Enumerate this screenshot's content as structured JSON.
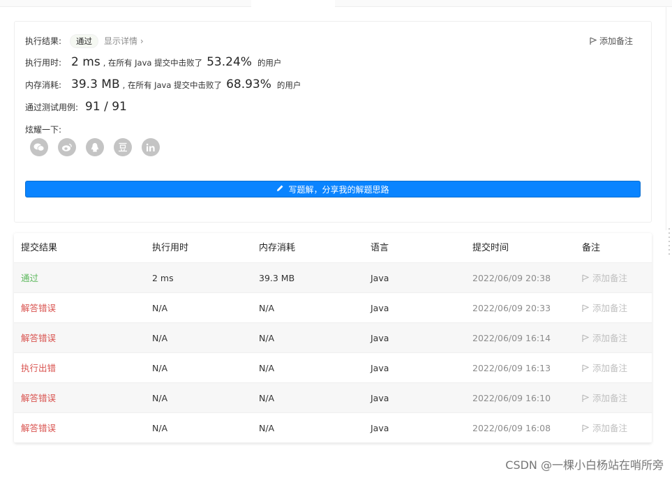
{
  "result": {
    "exec_result_label": "执行结果:",
    "exec_result_value": "通过",
    "show_details": "显示详情",
    "show_details_chevron": "›",
    "add_note": "添加备注",
    "time_label": "执行用时:",
    "time_value": "2 ms",
    "time_mid": ", 在所有 Java 提交中击败了",
    "time_pct": "53.24%",
    "time_tail": "的用户",
    "mem_label": "内存消耗:",
    "mem_value": "39.3 MB",
    "mem_mid": ", 在所有 Java 提交中击败了",
    "mem_pct": "68.93%",
    "mem_tail": "的用户",
    "tests_label": "通过测试用例:",
    "tests_value": "91 / 91",
    "share_label": "炫耀一下:",
    "share_icons": [
      "wechat-icon",
      "weibo-icon",
      "qq-icon",
      "douban-icon",
      "linkedin-icon"
    ],
    "write_solution": "写题解，分享我的解题思路"
  },
  "table": {
    "headers": [
      "提交结果",
      "执行用时",
      "内存消耗",
      "语言",
      "提交时间",
      "备注"
    ],
    "rows": [
      {
        "status": "通过",
        "kind": "pass",
        "time": "2 ms",
        "memory": "39.3 MB",
        "lang": "Java",
        "submitted": "2022/06/09 20:38",
        "note": "添加备注"
      },
      {
        "status": "解答错误",
        "kind": "fail",
        "time": "N/A",
        "memory": "N/A",
        "lang": "Java",
        "submitted": "2022/06/09 20:33",
        "note": "添加备注"
      },
      {
        "status": "解答错误",
        "kind": "fail",
        "time": "N/A",
        "memory": "N/A",
        "lang": "Java",
        "submitted": "2022/06/09 16:14",
        "note": "添加备注"
      },
      {
        "status": "执行出错",
        "kind": "fail",
        "time": "N/A",
        "memory": "N/A",
        "lang": "Java",
        "submitted": "2022/06/09 16:13",
        "note": "添加备注"
      },
      {
        "status": "解答错误",
        "kind": "fail",
        "time": "N/A",
        "memory": "N/A",
        "lang": "Java",
        "submitted": "2022/06/09 16:10",
        "note": "添加备注"
      },
      {
        "status": "解答错误",
        "kind": "fail",
        "time": "N/A",
        "memory": "N/A",
        "lang": "Java",
        "submitted": "2022/06/09 16:08",
        "note": "添加备注"
      }
    ]
  },
  "watermark": "CSDN @一棵小白杨站在哨所旁",
  "colors": {
    "accent": "#0a84ff",
    "pass": "#5cb85c",
    "fail": "#d9534f"
  }
}
